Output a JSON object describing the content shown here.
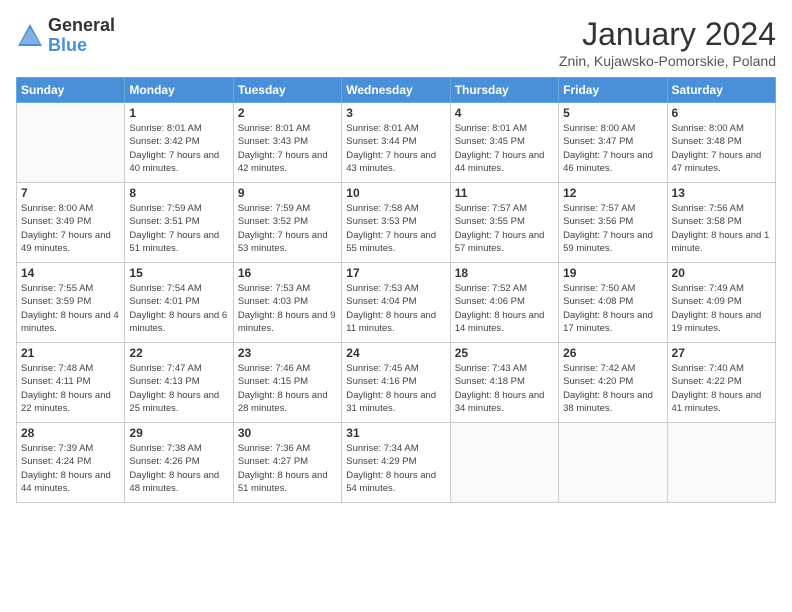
{
  "header": {
    "logo_general": "General",
    "logo_blue": "Blue",
    "month_title": "January 2024",
    "location": "Znin, Kujawsko-Pomorskie, Poland"
  },
  "days_of_week": [
    "Sunday",
    "Monday",
    "Tuesday",
    "Wednesday",
    "Thursday",
    "Friday",
    "Saturday"
  ],
  "weeks": [
    [
      {
        "day": "",
        "sunrise": "",
        "sunset": "",
        "daylight": ""
      },
      {
        "day": "1",
        "sunrise": "Sunrise: 8:01 AM",
        "sunset": "Sunset: 3:42 PM",
        "daylight": "Daylight: 7 hours and 40 minutes."
      },
      {
        "day": "2",
        "sunrise": "Sunrise: 8:01 AM",
        "sunset": "Sunset: 3:43 PM",
        "daylight": "Daylight: 7 hours and 42 minutes."
      },
      {
        "day": "3",
        "sunrise": "Sunrise: 8:01 AM",
        "sunset": "Sunset: 3:44 PM",
        "daylight": "Daylight: 7 hours and 43 minutes."
      },
      {
        "day": "4",
        "sunrise": "Sunrise: 8:01 AM",
        "sunset": "Sunset: 3:45 PM",
        "daylight": "Daylight: 7 hours and 44 minutes."
      },
      {
        "day": "5",
        "sunrise": "Sunrise: 8:00 AM",
        "sunset": "Sunset: 3:47 PM",
        "daylight": "Daylight: 7 hours and 46 minutes."
      },
      {
        "day": "6",
        "sunrise": "Sunrise: 8:00 AM",
        "sunset": "Sunset: 3:48 PM",
        "daylight": "Daylight: 7 hours and 47 minutes."
      }
    ],
    [
      {
        "day": "7",
        "sunrise": "Sunrise: 8:00 AM",
        "sunset": "Sunset: 3:49 PM",
        "daylight": "Daylight: 7 hours and 49 minutes."
      },
      {
        "day": "8",
        "sunrise": "Sunrise: 7:59 AM",
        "sunset": "Sunset: 3:51 PM",
        "daylight": "Daylight: 7 hours and 51 minutes."
      },
      {
        "day": "9",
        "sunrise": "Sunrise: 7:59 AM",
        "sunset": "Sunset: 3:52 PM",
        "daylight": "Daylight: 7 hours and 53 minutes."
      },
      {
        "day": "10",
        "sunrise": "Sunrise: 7:58 AM",
        "sunset": "Sunset: 3:53 PM",
        "daylight": "Daylight: 7 hours and 55 minutes."
      },
      {
        "day": "11",
        "sunrise": "Sunrise: 7:57 AM",
        "sunset": "Sunset: 3:55 PM",
        "daylight": "Daylight: 7 hours and 57 minutes."
      },
      {
        "day": "12",
        "sunrise": "Sunrise: 7:57 AM",
        "sunset": "Sunset: 3:56 PM",
        "daylight": "Daylight: 7 hours and 59 minutes."
      },
      {
        "day": "13",
        "sunrise": "Sunrise: 7:56 AM",
        "sunset": "Sunset: 3:58 PM",
        "daylight": "Daylight: 8 hours and 1 minute."
      }
    ],
    [
      {
        "day": "14",
        "sunrise": "Sunrise: 7:55 AM",
        "sunset": "Sunset: 3:59 PM",
        "daylight": "Daylight: 8 hours and 4 minutes."
      },
      {
        "day": "15",
        "sunrise": "Sunrise: 7:54 AM",
        "sunset": "Sunset: 4:01 PM",
        "daylight": "Daylight: 8 hours and 6 minutes."
      },
      {
        "day": "16",
        "sunrise": "Sunrise: 7:53 AM",
        "sunset": "Sunset: 4:03 PM",
        "daylight": "Daylight: 8 hours and 9 minutes."
      },
      {
        "day": "17",
        "sunrise": "Sunrise: 7:53 AM",
        "sunset": "Sunset: 4:04 PM",
        "daylight": "Daylight: 8 hours and 11 minutes."
      },
      {
        "day": "18",
        "sunrise": "Sunrise: 7:52 AM",
        "sunset": "Sunset: 4:06 PM",
        "daylight": "Daylight: 8 hours and 14 minutes."
      },
      {
        "day": "19",
        "sunrise": "Sunrise: 7:50 AM",
        "sunset": "Sunset: 4:08 PM",
        "daylight": "Daylight: 8 hours and 17 minutes."
      },
      {
        "day": "20",
        "sunrise": "Sunrise: 7:49 AM",
        "sunset": "Sunset: 4:09 PM",
        "daylight": "Daylight: 8 hours and 19 minutes."
      }
    ],
    [
      {
        "day": "21",
        "sunrise": "Sunrise: 7:48 AM",
        "sunset": "Sunset: 4:11 PM",
        "daylight": "Daylight: 8 hours and 22 minutes."
      },
      {
        "day": "22",
        "sunrise": "Sunrise: 7:47 AM",
        "sunset": "Sunset: 4:13 PM",
        "daylight": "Daylight: 8 hours and 25 minutes."
      },
      {
        "day": "23",
        "sunrise": "Sunrise: 7:46 AM",
        "sunset": "Sunset: 4:15 PM",
        "daylight": "Daylight: 8 hours and 28 minutes."
      },
      {
        "day": "24",
        "sunrise": "Sunrise: 7:45 AM",
        "sunset": "Sunset: 4:16 PM",
        "daylight": "Daylight: 8 hours and 31 minutes."
      },
      {
        "day": "25",
        "sunrise": "Sunrise: 7:43 AM",
        "sunset": "Sunset: 4:18 PM",
        "daylight": "Daylight: 8 hours and 34 minutes."
      },
      {
        "day": "26",
        "sunrise": "Sunrise: 7:42 AM",
        "sunset": "Sunset: 4:20 PM",
        "daylight": "Daylight: 8 hours and 38 minutes."
      },
      {
        "day": "27",
        "sunrise": "Sunrise: 7:40 AM",
        "sunset": "Sunset: 4:22 PM",
        "daylight": "Daylight: 8 hours and 41 minutes."
      }
    ],
    [
      {
        "day": "28",
        "sunrise": "Sunrise: 7:39 AM",
        "sunset": "Sunset: 4:24 PM",
        "daylight": "Daylight: 8 hours and 44 minutes."
      },
      {
        "day": "29",
        "sunrise": "Sunrise: 7:38 AM",
        "sunset": "Sunset: 4:26 PM",
        "daylight": "Daylight: 8 hours and 48 minutes."
      },
      {
        "day": "30",
        "sunrise": "Sunrise: 7:36 AM",
        "sunset": "Sunset: 4:27 PM",
        "daylight": "Daylight: 8 hours and 51 minutes."
      },
      {
        "day": "31",
        "sunrise": "Sunrise: 7:34 AM",
        "sunset": "Sunset: 4:29 PM",
        "daylight": "Daylight: 8 hours and 54 minutes."
      },
      {
        "day": "",
        "sunrise": "",
        "sunset": "",
        "daylight": ""
      },
      {
        "day": "",
        "sunrise": "",
        "sunset": "",
        "daylight": ""
      },
      {
        "day": "",
        "sunrise": "",
        "sunset": "",
        "daylight": ""
      }
    ]
  ]
}
